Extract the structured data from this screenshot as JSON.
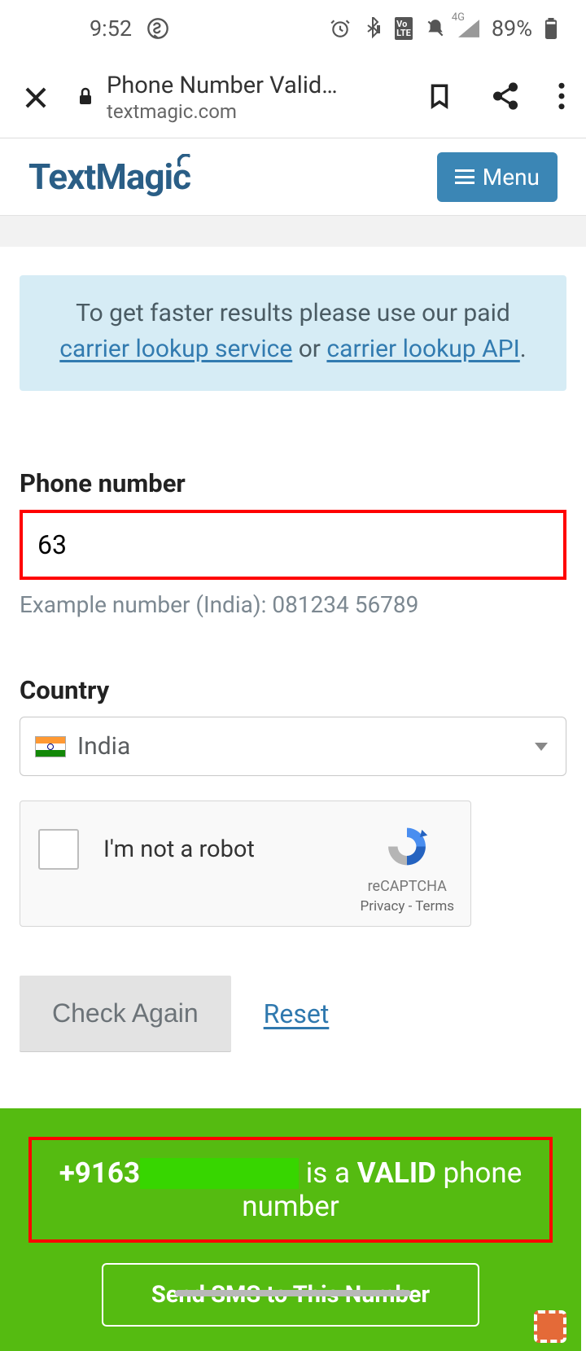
{
  "statusbar": {
    "time": "9:52",
    "battery": "89%",
    "network_tag": "4G"
  },
  "browser": {
    "title": "Phone Number Valid…",
    "host": "textmagic.com"
  },
  "site": {
    "brand": "TextMagic",
    "menu_label": "Menu"
  },
  "notice": {
    "lead": "To get faster results please use our paid ",
    "link1": "carrier lookup service",
    "or": " or ",
    "link2": "carrier lookup API",
    "tail": "."
  },
  "form": {
    "phone_label": "Phone number",
    "phone_value": "63",
    "example": "Example number (India): 081234 56789",
    "country_label": "Country",
    "country_value": "India",
    "recaptcha_label": "I'm not a robot",
    "recaptcha_brand": "reCAPTCHA",
    "recaptcha_privacy": "Privacy",
    "recaptcha_dash": " - ",
    "recaptcha_terms": "Terms",
    "check_label": "Check Again",
    "reset_label": "Reset"
  },
  "result": {
    "prefix": "+9163",
    "mid": " is a ",
    "valid": "VALID",
    "suffix": " phone number",
    "sms_label": "Send SMS to This Number"
  }
}
